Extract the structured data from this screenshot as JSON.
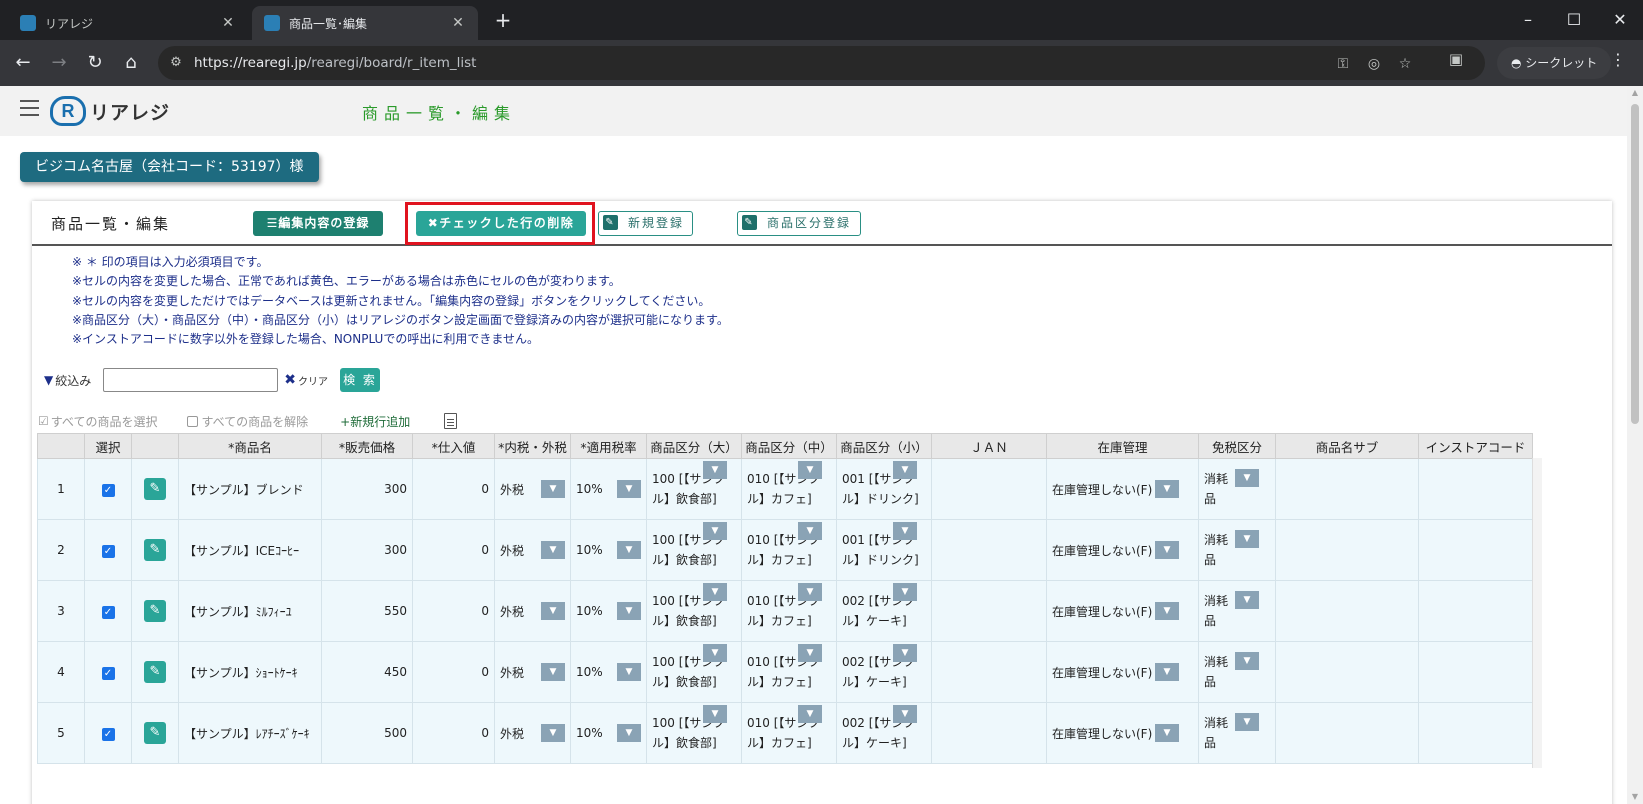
{
  "browser": {
    "tabs": [
      {
        "title": "リアレジ"
      },
      {
        "title": "商品一覧･編集"
      }
    ],
    "url_host": "https://rearegi.jp",
    "url_path": "/rearegi/board/r_item_list",
    "profile_label": "シークレット"
  },
  "app": {
    "logo_text": "リアレジ",
    "logo_mark": "R",
    "page_title": "商品一覧・編集",
    "company": "ビジコム名古屋（会社コード：53197）様"
  },
  "panel": {
    "title": "商品一覧・編集",
    "save_label": "編集内容の登録",
    "delete_label": "チェックした行の削除",
    "new_label": "新規登録",
    "category_label": "商品区分登録"
  },
  "notes": [
    "※ ＊ 印の項目は入力必須項目です。",
    "※セルの内容を変更した場合、正常であれば黄色、エラーがある場合は赤色にセルの色が変わります。",
    "※セルの内容を変更しただけではデータベースは更新されません。「編集内容の登録」ボタンをクリックしてください。",
    "※商品区分（大）・商品区分（中）・商品区分（小）はリアレジのボタン設定画面で登録済みの内容が選択可能になります。",
    "※インストアコードに数字以外を登録した場合、NONPLUでの呼出に利用できません。"
  ],
  "filter": {
    "label": "絞込み",
    "input_value": "",
    "clear_label": "クリア",
    "search_label": "検 索"
  },
  "selection": {
    "select_all": "すべての商品を選択",
    "deselect_all": "すべての商品を解除",
    "add_row": "+新規行追加"
  },
  "grid": {
    "headers": [
      "",
      "選択",
      "",
      "*商品名",
      "*販売価格",
      "*仕入値",
      "*内税・外税",
      "*適用税率",
      "商品区分（大）",
      "商品区分（中）",
      "商品区分（小）",
      "ＪＡＮ",
      "在庫管理",
      "免税区分",
      "商品名サブ",
      "インストアコード"
    ],
    "rows": [
      {
        "no": "1",
        "checked": true,
        "name": "【サンプル】ブレンド",
        "price": "300",
        "cost": "0",
        "tax_type": "外税",
        "tax_rate": "10%",
        "cat_l": "100 [【サンプル】飲食部]",
        "cat_m": "010 [【サンプル】カフェ]",
        "cat_s": "001 [【サンプル】ドリンク]",
        "jan": "",
        "stock": "在庫管理しない(F)",
        "dutyfree": "消耗品",
        "subname": "",
        "instore": ""
      },
      {
        "no": "2",
        "checked": true,
        "name": "【サンプル】ICEｺｰﾋｰ",
        "price": "300",
        "cost": "0",
        "tax_type": "外税",
        "tax_rate": "10%",
        "cat_l": "100 [【サンプル】飲食部]",
        "cat_m": "010 [【サンプル】カフェ]",
        "cat_s": "001 [【サンプル】ドリンク]",
        "jan": "",
        "stock": "在庫管理しない(F)",
        "dutyfree": "消耗品",
        "subname": "",
        "instore": ""
      },
      {
        "no": "3",
        "checked": true,
        "name": "【サンプル】ﾐﾙﾌｨｰﾕ",
        "price": "550",
        "cost": "0",
        "tax_type": "外税",
        "tax_rate": "10%",
        "cat_l": "100 [【サンプル】飲食部]",
        "cat_m": "010 [【サンプル】カフェ]",
        "cat_s": "002 [【サンプル】ケーキ]",
        "jan": "",
        "stock": "在庫管理しない(F)",
        "dutyfree": "消耗品",
        "subname": "",
        "instore": ""
      },
      {
        "no": "4",
        "checked": true,
        "name": "【サンプル】ｼｮｰﾄｹｰｷ",
        "price": "450",
        "cost": "0",
        "tax_type": "外税",
        "tax_rate": "10%",
        "cat_l": "100 [【サンプル】飲食部]",
        "cat_m": "010 [【サンプル】カフェ]",
        "cat_s": "002 [【サンプル】ケーキ]",
        "jan": "",
        "stock": "在庫管理しない(F)",
        "dutyfree": "消耗品",
        "subname": "",
        "instore": ""
      },
      {
        "no": "5",
        "checked": true,
        "name": "【サンプル】ﾚｱﾁｰｽﾞｹｰｷ",
        "price": "500",
        "cost": "0",
        "tax_type": "外税",
        "tax_rate": "10%",
        "cat_l": "100 [【サンプル】飲食部]",
        "cat_m": "010 [【サンプル】カフェ]",
        "cat_s": "002 [【サンプル】ケーキ]",
        "jan": "",
        "stock": "在庫管理しない(F)",
        "dutyfree": "消耗品",
        "subname": "",
        "instore": ""
      }
    ]
  },
  "colors": {
    "accent": "#2aa598",
    "header_bar": "#1e6b80",
    "highlight": "#e0131f",
    "notes_text": "#1d2f8a",
    "title_green": "#2a9a2a"
  }
}
